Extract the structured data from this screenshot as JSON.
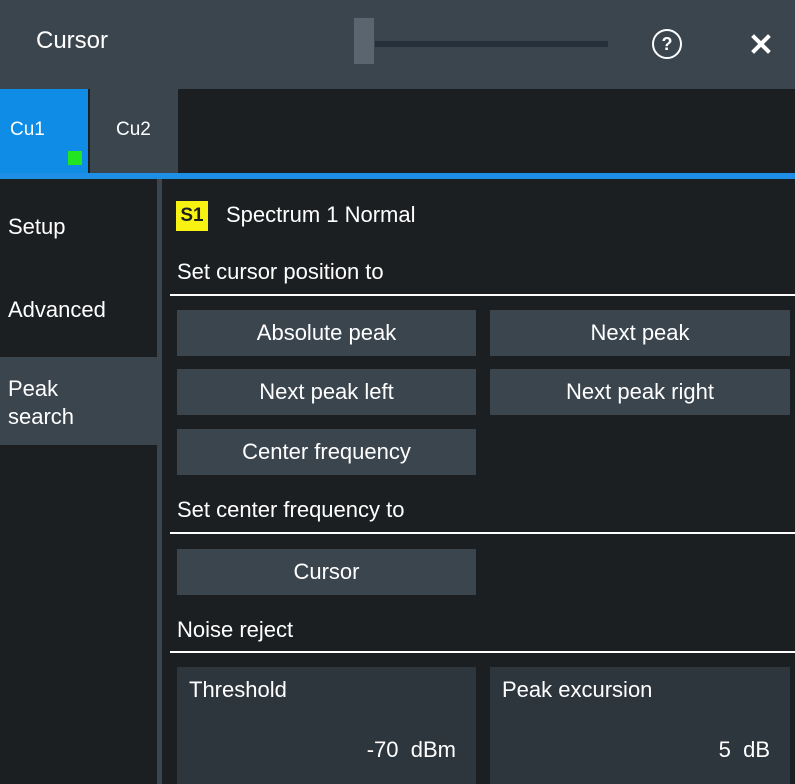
{
  "window": {
    "title": "Cursor",
    "help_icon": "help-circle-icon",
    "help_glyph": "?",
    "close_icon": "close-icon"
  },
  "tabs": [
    {
      "label": "Cu1",
      "active": true,
      "indicator_color": "#22e522"
    },
    {
      "label": "Cu2",
      "active": false
    }
  ],
  "sidebar": {
    "items": [
      {
        "label": "Setup",
        "selected": false
      },
      {
        "label": "Advanced",
        "selected": false
      },
      {
        "label": "Peak search",
        "label_lines": [
          "Peak",
          "search"
        ],
        "selected": true
      }
    ]
  },
  "source": {
    "badge": "S1",
    "badge_color": "#f7f212",
    "name": "Spectrum 1 Normal"
  },
  "cursor_position": {
    "heading": "Set cursor position to",
    "buttons": {
      "absolute_peak": "Absolute peak",
      "next_peak": "Next peak",
      "next_peak_left": "Next peak left",
      "next_peak_right": "Next peak right",
      "center_frequency": "Center frequency"
    }
  },
  "center_frequency": {
    "heading": "Set center frequency to",
    "cursor_button": "Cursor"
  },
  "noise_reject": {
    "heading": "Noise reject",
    "threshold": {
      "label": "Threshold",
      "value": "-70  dBm"
    },
    "peak_excursion": {
      "label": "Peak excursion",
      "value": "5  dB"
    }
  },
  "colors": {
    "accent": "#1e8fe6",
    "active_tab": "#0f8ce6",
    "panel": "#3a454e",
    "background": "#1c1f21"
  }
}
